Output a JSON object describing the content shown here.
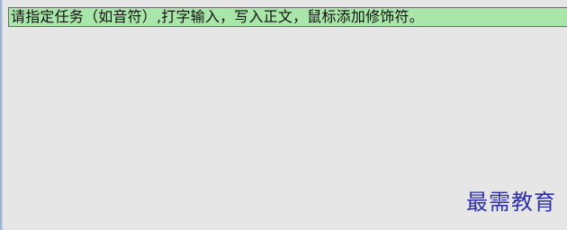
{
  "prompt": {
    "text": "请指定任务（如音符）,打字输入，写入正文，鼠标添加修饰符。"
  },
  "watermark": {
    "text": "最需教育"
  },
  "colors": {
    "prompt_background": "#a9e6a9",
    "canvas_background": "#e6e6e6",
    "watermark": "#2f2fa8"
  }
}
